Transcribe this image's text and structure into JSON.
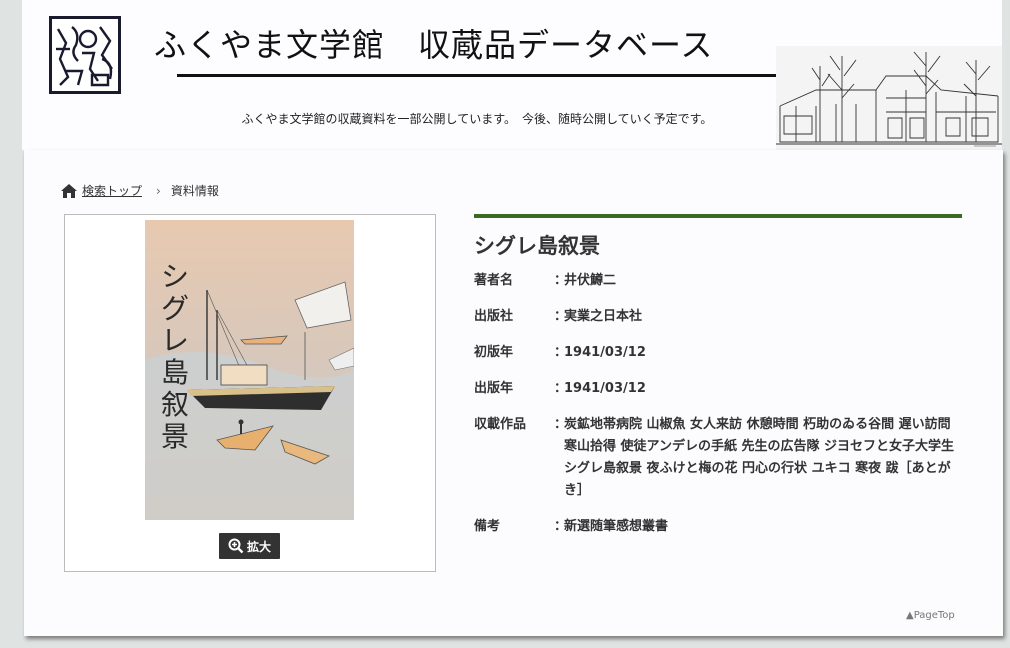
{
  "header": {
    "title": "ふくやま文学館　収蔵品データベース",
    "subtitle": "ふくやま文学館の収蔵資料を一部公開しています。　今後、随時公開していく予定です。"
  },
  "breadcrumb": {
    "home_label": "検索トップ",
    "current_label": "資料情報"
  },
  "image_panel": {
    "zoom_label": "拡大",
    "cover_title_text": "シグレ島叙景"
  },
  "detail": {
    "title": "シグレ島叙景",
    "fields": [
      {
        "label": "著者名",
        "value": "井伏鱒二"
      },
      {
        "label": "出版社",
        "value": "実業之日本社"
      },
      {
        "label": "初版年",
        "value": "1941/03/12"
      },
      {
        "label": "出版年",
        "value": "1941/03/12"
      },
      {
        "label": "収載作品",
        "value": "炭鉱地帯病院 山椒魚 女人来訪 休憩時間 朽助のゐる谷間 遅い訪問 寒山拾得 使徒アンデレの手紙 先生の広告隊 ジヨセフと女子大学生 シグレ島叙景 夜ふけと梅の花 円心の行状 ユキコ 寒夜 跋［あとがき］"
      },
      {
        "label": "備考",
        "value": "新選随筆感想叢書"
      }
    ]
  },
  "footer": {
    "pagetop_label": "▲PageTop"
  },
  "colors": {
    "accent_rule": "#3a6a25",
    "zoom_button_bg": "#333333",
    "page_bg": "#fcfbfe"
  },
  "icons": [
    "home-icon",
    "zoom-in-icon"
  ]
}
